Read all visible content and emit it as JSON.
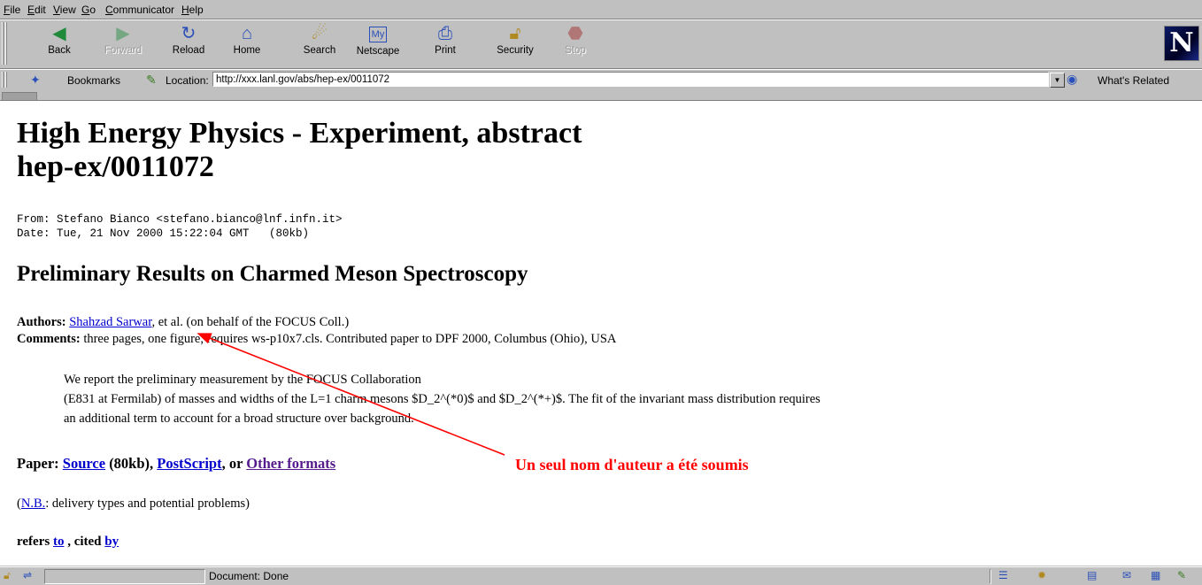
{
  "menu": [
    "File",
    "Edit",
    "View",
    "Go",
    "Communicator",
    "Help"
  ],
  "toolbar": {
    "back": "Back",
    "forward": "Forward",
    "reload": "Reload",
    "home": "Home",
    "search": "Search",
    "netscape": "Netscape",
    "print": "Print",
    "security": "Security",
    "stop": "Stop"
  },
  "location": {
    "bookmarks_label": "Bookmarks",
    "location_label": "Location:",
    "url": "http://xxx.lanl.gov/abs/hep-ex/0011072",
    "related_label": "What's Related"
  },
  "page": {
    "title_line1": "High Energy Physics - Experiment, abstract",
    "title_line2": "hep-ex/0011072",
    "from": "From: Stefano Bianco <stefano.bianco@lnf.infn.it>",
    "date": "Date: Tue, 21 Nov 2000 15:22:04 GMT   (80kb)",
    "paper_title": "Preliminary Results on Charmed Meson Spectroscopy",
    "authors_label": "Authors:",
    "author_link": "Shahzad Sarwar",
    "authors_rest": ", et al. (on behalf of the FOCUS Coll.)",
    "comments_label": "Comments:",
    "comments_text": " three pages, one figure, requires ws-p10x7.cls. Contributed paper to DPF 2000, Columbus (Ohio), USA",
    "abstract_1": "We report the preliminary measurement by the FOCUS Collaboration",
    "abstract_2": "(E831 at Fermilab) of masses and widths of the L=1 charm mesons $D_2^(*0)$ and $D_2^(*+)$. The fit of the invariant mass distribution requires",
    "abstract_3": "an additional term to account for a broad structure over background.",
    "paper_label": "Paper: ",
    "source_link": "Source",
    "source_size": " (80kb), ",
    "postscript_link": "PostScript",
    "or_text": ", or ",
    "other_link": "Other formats",
    "nb_link": "N.B.",
    "nb_text": ": delivery types and potential problems)",
    "refers_label": "refers ",
    "to_link": "to",
    "cited_label": " , cited ",
    "by_link": "by",
    "annotation": "Un seul nom d'auteur a été soumis"
  },
  "status": {
    "text": "Document: Done"
  },
  "colors": {
    "link": "#0000cc",
    "visited": "#551a8b",
    "annotation": "#ff0000",
    "chrome": "#c0c0c0"
  },
  "icons": [
    "back-icon",
    "forward-icon",
    "reload-icon",
    "home-icon",
    "search-icon",
    "netscape-icon",
    "print-icon",
    "security-icon",
    "stop-icon",
    "netscape-logo"
  ]
}
